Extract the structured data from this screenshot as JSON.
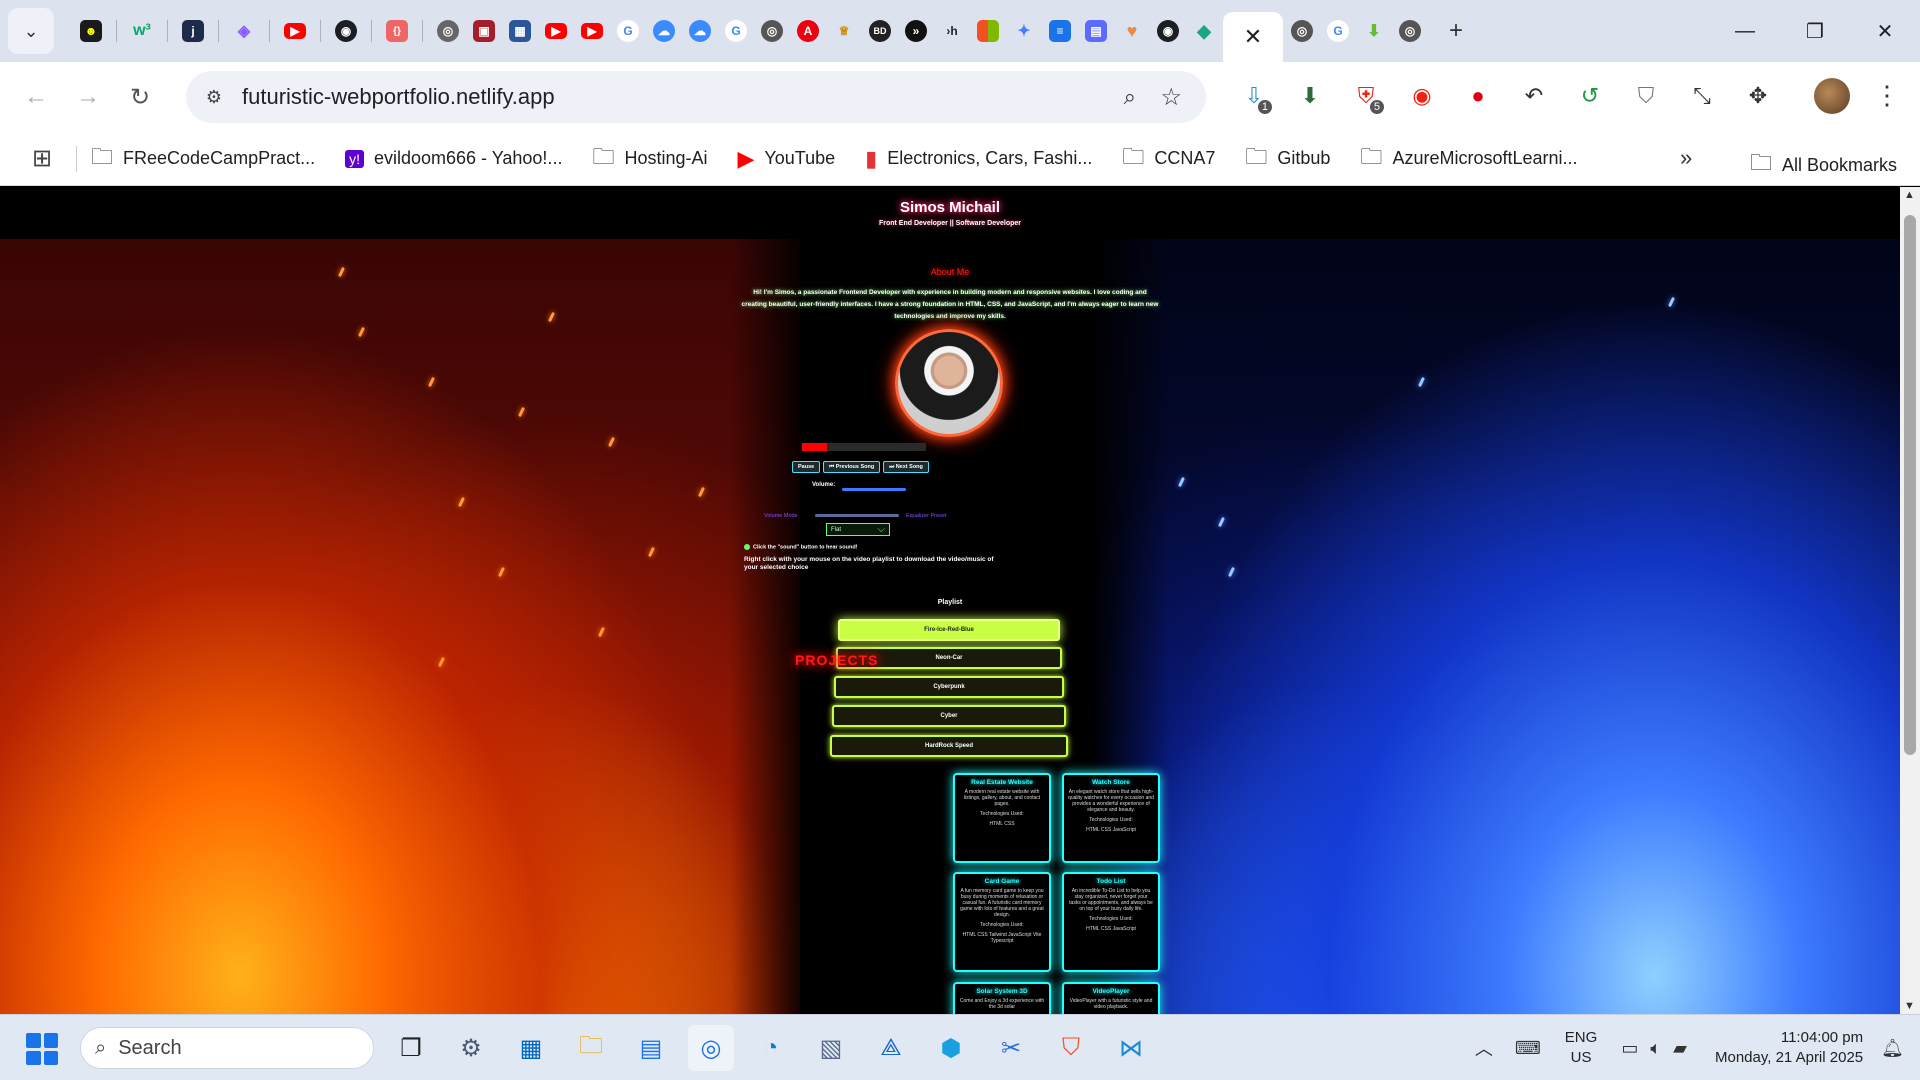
{
  "browser": {
    "active_tab_close": "✕",
    "new_tab": "+",
    "url": "futuristic-webportfolio.netlify.app",
    "bookmarks": [
      {
        "label": "FReeCodeCampPract...",
        "icon": "folder-icon"
      },
      {
        "label": "evildoom666 - Yahoo!...",
        "icon": "yahoo-icon"
      },
      {
        "label": "Hosting-Ai",
        "icon": "folder-icon"
      },
      {
        "label": "YouTube",
        "icon": "youtube-icon"
      },
      {
        "label": "Electronics, Cars, Fashi...",
        "icon": "ebay-icon"
      },
      {
        "label": "CCNA7",
        "icon": "folder-icon"
      },
      {
        "label": "Gitbub",
        "icon": "folder-icon"
      },
      {
        "label": "AzureMicrosoftLearni...",
        "icon": "folder-icon"
      }
    ],
    "all_bookmarks": "All Bookmarks",
    "extension_badges": {
      "first": "1",
      "second": "5"
    }
  },
  "site": {
    "title": "Simos Michail",
    "subtitle": "Front End Developer || Software Developer",
    "about_title": "About Me",
    "about_text": "Hi! I'm Simos, a passionate Frontend Developer with experience in building modern and responsive websites. I love coding and creating beautiful, user-friendly interfaces. I have a strong foundation in HTML, CSS, and JavaScript, and I'm always eager to learn new technologies and improve my skills.",
    "song_progress": 0.2,
    "controls": [
      "Pause",
      "⏮ Previous Song",
      "⏭ Next Song"
    ],
    "volume_label": "Volume:",
    "visualizer_mode": "Volume Mode",
    "equalizer_preset": "Equalizer Preset",
    "preset_value": "Flat",
    "hint_click": "Click the \"sound\" button to hear sound!",
    "hint_right_click": "Right click with your mouse on the video playlist to download the video/music of your selected choice",
    "playlist_title": "Playlist",
    "playlist": [
      "Fire-Ice-Red-Blue",
      "Neon-Car",
      "Cyberpunk",
      "Cyber",
      "HardRock Speed"
    ],
    "projects_title": "PROJECTS",
    "projects": [
      {
        "title": "Real Estate Website",
        "desc": "A modern real estate website with listings, gallery, about, and contact pages.",
        "tech_label": "Technologies Used:",
        "tech": "HTML CSS"
      },
      {
        "title": "Watch Store",
        "desc": "An elegant watch store that sells high-quality watches for every occasion and provides a wonderful experience of elegance and beauty.",
        "tech_label": "Technologies Used:",
        "tech": "HTML CSS JavaScript"
      },
      {
        "title": "Card Game",
        "desc": "A fun memory card game to keep you busy during moments of relaxation or casual fun. A futuristic card memory game with lots of features and a great design.",
        "tech_label": "Technologies Used:",
        "tech": "HTML CSS Tailwind JavaScript Vite Typescript"
      },
      {
        "title": "Todo List",
        "desc": "An incredible To-Do List to help you stay organized, never forget your tasks or appointments, and always be on top of your busy daily life.",
        "tech_label": "Technologies Used:",
        "tech": "HTML CSS JavaScript"
      },
      {
        "title": "Solar System 3D",
        "desc": "Come and Enjoy a 3d experience with the 3d solar",
        "tech_label": "",
        "tech": ""
      },
      {
        "title": "VideoPlayer",
        "desc": "VideoPlayer with a futuristic style and video playback.",
        "tech_label": "",
        "tech": ""
      }
    ]
  },
  "taskbar": {
    "search_placeholder": "Search",
    "lang_top": "ENG",
    "lang_bottom": "US",
    "time": "11:04:00 pm",
    "date": "Monday, 21 April 2025"
  }
}
